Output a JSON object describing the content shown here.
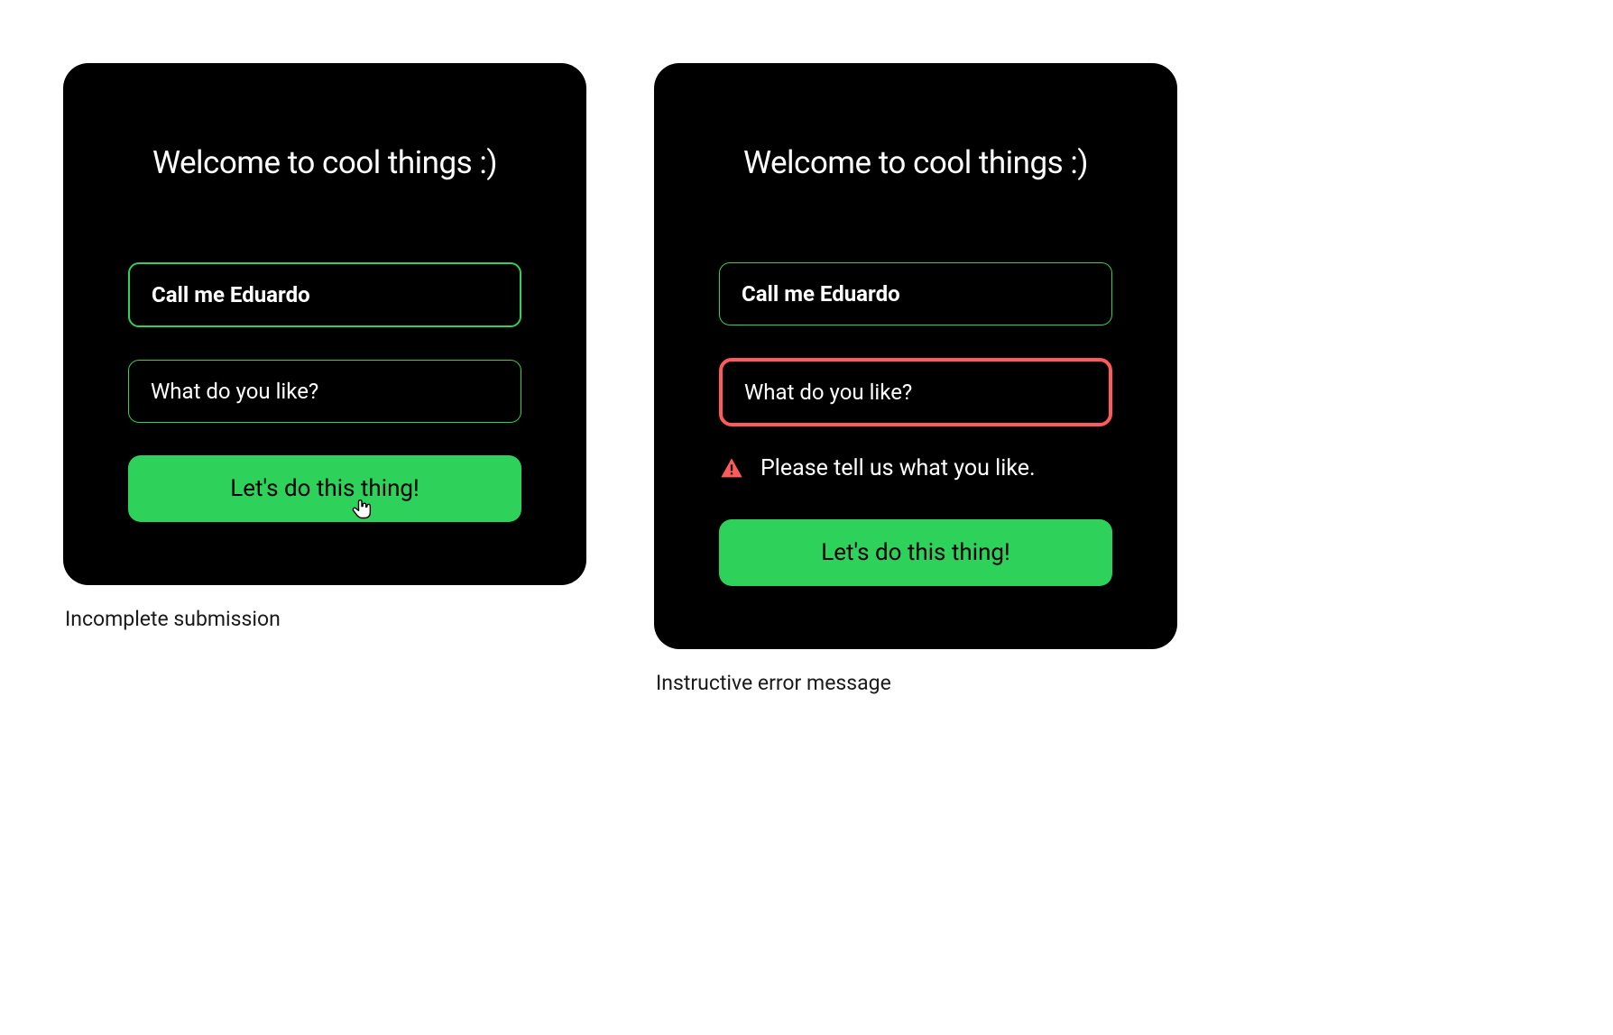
{
  "colors": {
    "accent_green": "#2ED159",
    "error_red": "#FF5A5A",
    "card_bg": "#000000"
  },
  "left": {
    "title": "Welcome to cool things :)",
    "name_value": "Call me Eduardo",
    "like_placeholder": "What do you like?",
    "submit_label": "Let's do this thing!",
    "caption": "Incomplete submission"
  },
  "right": {
    "title": "Welcome to cool things :)",
    "name_value": "Call me Eduardo",
    "like_placeholder": "What do you like?",
    "error_message": "Please tell us what you like.",
    "submit_label": "Let's do this thing!",
    "caption": "Instructive error message"
  }
}
